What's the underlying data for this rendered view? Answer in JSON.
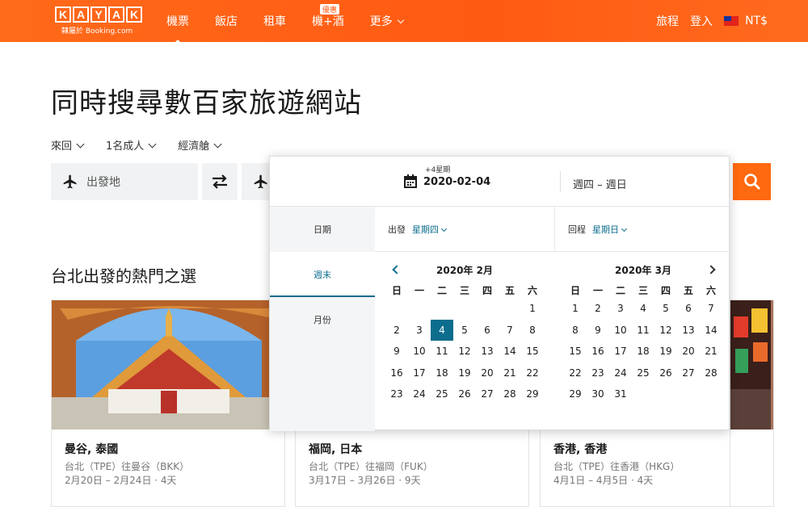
{
  "header": {
    "logo_letters": [
      "K",
      "A",
      "Y",
      "A",
      "K"
    ],
    "logo_sub": "隸屬於 Booking.com",
    "nav": [
      "機票",
      "飯店",
      "租車",
      "機+酒",
      "更多"
    ],
    "deal_badge": "優惠",
    "trips": "旅程",
    "login": "登入",
    "currency": "NT$"
  },
  "page": {
    "title": "同時搜尋數百家旅遊網站",
    "trip_type": "來回",
    "travelers": "1名成人",
    "cabin": "經濟艙",
    "origin_placeholder": "出發地",
    "popular_heading": "台北出發的熱門之選"
  },
  "datepicker": {
    "plus_label": "+4星期",
    "date_value": "2020-02-04",
    "days_range": "週四 – 週日",
    "tabs": [
      "日期",
      "週末",
      "月份"
    ],
    "depart_label": "出發",
    "depart_day": "星期四",
    "return_label": "回程",
    "return_day": "星期日",
    "weekdays": [
      "日",
      "一",
      "二",
      "三",
      "四",
      "五",
      "六"
    ],
    "months": [
      {
        "title": "2020年 2月",
        "offset": 6,
        "days": 29
      },
      {
        "title": "2020年 3月",
        "offset": 0,
        "days": 31
      }
    ],
    "selected": "2020-02-04"
  },
  "cards": [
    {
      "city": "曼谷, 泰國",
      "route": "台北（TPE）往曼谷（BKK）",
      "dates": "2月20日 – 2月24日 · 4天"
    },
    {
      "city": "福岡, 日本",
      "route": "台北（TPE）往福岡（FUK）",
      "dates": "3月17日 – 3月26日 · 9天"
    },
    {
      "city": "香港, 香港",
      "route": "台北（TPE）往香港（HKG）",
      "dates": "4月1日 – 4月5日 · 4天"
    }
  ],
  "colors": {
    "brand": "#ff690f",
    "accent": "#0c6d8d"
  }
}
